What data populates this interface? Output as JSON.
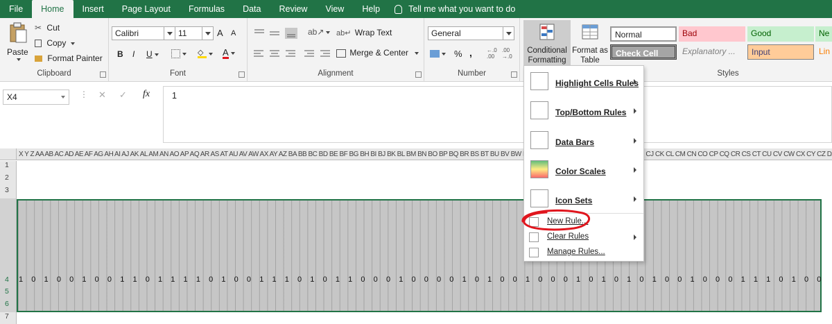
{
  "ribbon_tabs": [
    "File",
    "Home",
    "Insert",
    "Page Layout",
    "Formulas",
    "Data",
    "Review",
    "View",
    "Help"
  ],
  "tell_me": "Tell me what you want to do",
  "clipboard": {
    "paste": "Paste",
    "cut": "Cut",
    "copy": "Copy",
    "format_painter": "Format Painter",
    "label": "Clipboard"
  },
  "font": {
    "name": "Calibri",
    "size": "11",
    "bold": "B",
    "italic": "I",
    "underline": "U",
    "grow": "A",
    "shrink": "A",
    "font_color": "A",
    "label": "Font"
  },
  "alignment": {
    "wrap_text": "Wrap Text",
    "merge_center": "Merge & Center",
    "label": "Alignment"
  },
  "number": {
    "format": "General",
    "percent": "%",
    "comma": ",",
    "inc_decimal": "←.0 .00",
    "dec_decimal": ".00 →.0",
    "label": "Number"
  },
  "styles": {
    "conditional_formatting": "Conditional Formatting",
    "format_as_table": "Format as Table",
    "normal": "Normal",
    "bad": "Bad",
    "good": "Good",
    "neutral": "Ne",
    "check_cell": "Check Cell",
    "explanatory": "Explanatory ...",
    "input": "Input",
    "linked": "Lin",
    "label": "Styles"
  },
  "formula_bar": {
    "name_box": "X4",
    "fx": "fx",
    "cancel": "✕",
    "enter": "✓",
    "value": "1"
  },
  "columns": "X Y Z AA AB AC AD AE AF AG AH AI AJ AK AL AM AN AO AP AQ AR AS AT AU AV AW AX AY AZ BA BB BC BD BE BF BG BH BI BJ BK BL BM BN BO BP BQ BR BS BT BU BV BW BX BY BZ CA CB CC CD CE CF CG CH CI CJ CK CL CM CN CO CP CQ CR CS CT CU CV CW CX CY CZ DA DB DC DD DE DF DG DH DI DJ DK DL DM",
  "rows": [
    "1",
    "2",
    "3",
    "4",
    "5",
    "6",
    "7"
  ],
  "row4_values": "1 0 1 0 0 1 0 0 1 1 0 1 1 1 1 0 1 0 0 1 1 1 0 1 0 1 1 0 0 0 1 0 0 0 0 1 0 1 0 0 1 0 0 0 1 0 1 0 1 0 1 0 0 1 0 0 0 1 1 1 0 1 0 0 1 1 1 0 0 1 0 1 1 0 0 1 1 0 1 1 0 1 1 0 0 1 0 0 1 0 0 0 1 0 1",
  "cf_menu": {
    "highlight": "Highlight Cells Rules",
    "top_bottom": "Top/Bottom Rules",
    "data_bars": "Data Bars",
    "color_scales": "Color Scales",
    "icon_sets": "Icon Sets",
    "new_rule": "New Rule...",
    "clear_rules": "Clear Rules",
    "manage_rules": "Manage Rules..."
  },
  "colors": {
    "excel_green": "#217346",
    "annotation_red": "#e0161e",
    "selection_fill": "#c6c6c6"
  }
}
